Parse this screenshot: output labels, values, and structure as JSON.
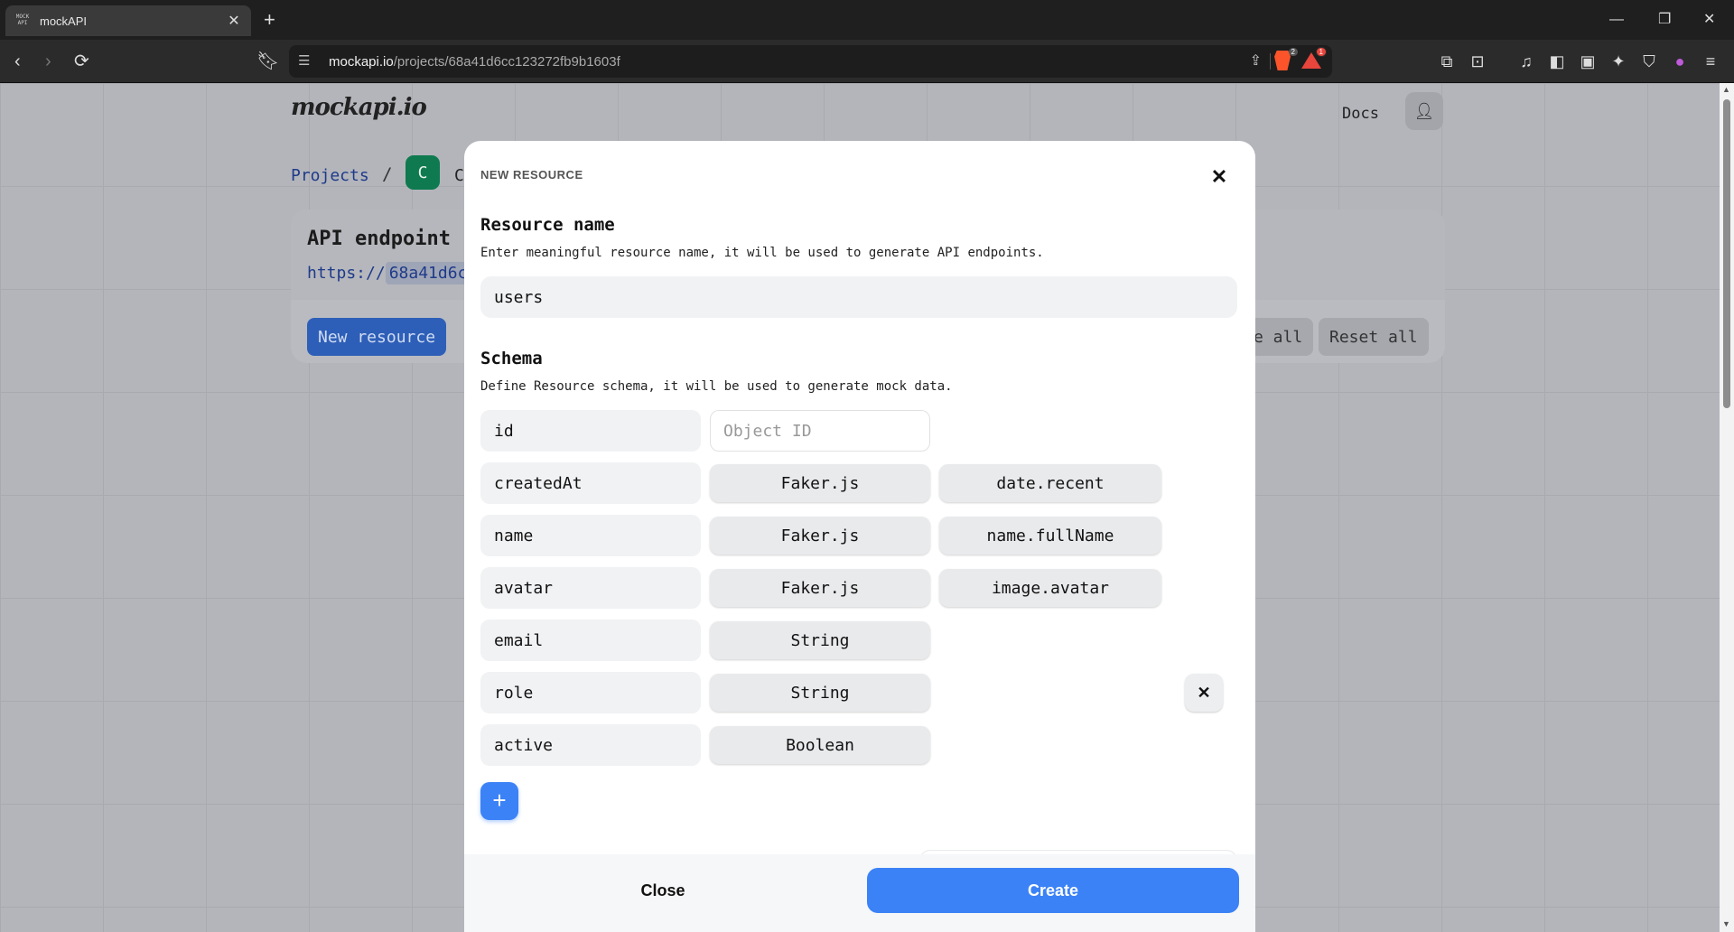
{
  "browser": {
    "tab_title": "mockAPI",
    "tab_favicon": "MOCK API",
    "url_host": "mockapi.io",
    "url_path": "/projects/68a41d6cc123272fb9b1603f",
    "brave_badge": "2",
    "rewards_badge": "1"
  },
  "page": {
    "logo": "mockapi.io",
    "docs": "Docs",
    "breadcrumb_projects": "Projects",
    "breadcrumb_sep": "/",
    "project_badge": "C",
    "project_name_visible": "C",
    "api_title": "API endpoint",
    "api_url_prefix": "https://",
    "api_url_id_visible": "68a41d6c",
    "new_resource": "New resource",
    "generate_all_visible": "e all",
    "reset_all": "Reset all"
  },
  "modal": {
    "heading": "NEW RESOURCE",
    "resource_name_title": "Resource name",
    "resource_name_desc": "Enter meaningful resource name, it will be used to generate API endpoints.",
    "resource_name_value": "users",
    "schema_title": "Schema",
    "schema_desc": "Define Resource schema, it will be used to generate mock data.",
    "schema": [
      {
        "field": "id",
        "type": "",
        "placeholder": "Object ID",
        "method": ""
      },
      {
        "field": "createdAt",
        "type": "Faker.js",
        "method": "date.recent"
      },
      {
        "field": "name",
        "type": "Faker.js",
        "method": "name.fullName"
      },
      {
        "field": "avatar",
        "type": "Faker.js",
        "method": "image.avatar"
      },
      {
        "field": "email",
        "type": "String",
        "method": ""
      },
      {
        "field": "role",
        "type": "String",
        "method": ""
      },
      {
        "field": "active",
        "type": "Boolean",
        "method": ""
      }
    ],
    "close": "Close",
    "create": "Create"
  },
  "icons": {
    "close": "close-icon",
    "add": "plus-icon",
    "user": "user-icon"
  },
  "colors": {
    "primary": "#3b82f6",
    "project_badge": "#0f7a4f"
  }
}
